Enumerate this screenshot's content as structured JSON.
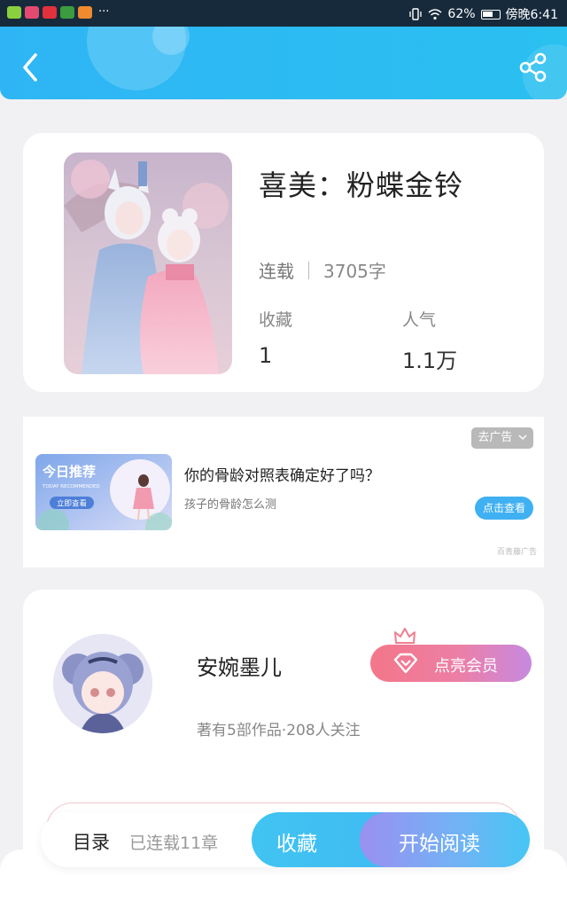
{
  "status_bar": {
    "battery": "62%",
    "time": "傍晚6:41",
    "more": "···"
  },
  "book": {
    "title": "喜美：粉蝶金铃",
    "status": "连载",
    "word_count": "3705字",
    "favorites_label": "收藏",
    "favorites_value": "1",
    "popularity_label": "人气",
    "popularity_value": "1.1万"
  },
  "ad": {
    "close_label": "去广告",
    "image_title": "今日推荐",
    "image_subtitle": "TODAY RECOMMENDED",
    "image_cta": "立即查看",
    "title": "你的骨龄对照表确定好了吗？",
    "subtitle": "孩子的骨龄怎么测",
    "cta": "点击查看",
    "source": "百青藤广告"
  },
  "author": {
    "name": "安婉墨儿",
    "meta": "著有5部作品·208人关注",
    "vip_label": "点亮会员"
  },
  "bottom": {
    "toc_label": "目录",
    "chapters": "已连载11章",
    "favorite_label": "收藏",
    "read_label": "开始阅读"
  },
  "colors": {
    "header": "#2fb5f5",
    "vip": "#f47688",
    "cta": "#3fb0f2"
  }
}
